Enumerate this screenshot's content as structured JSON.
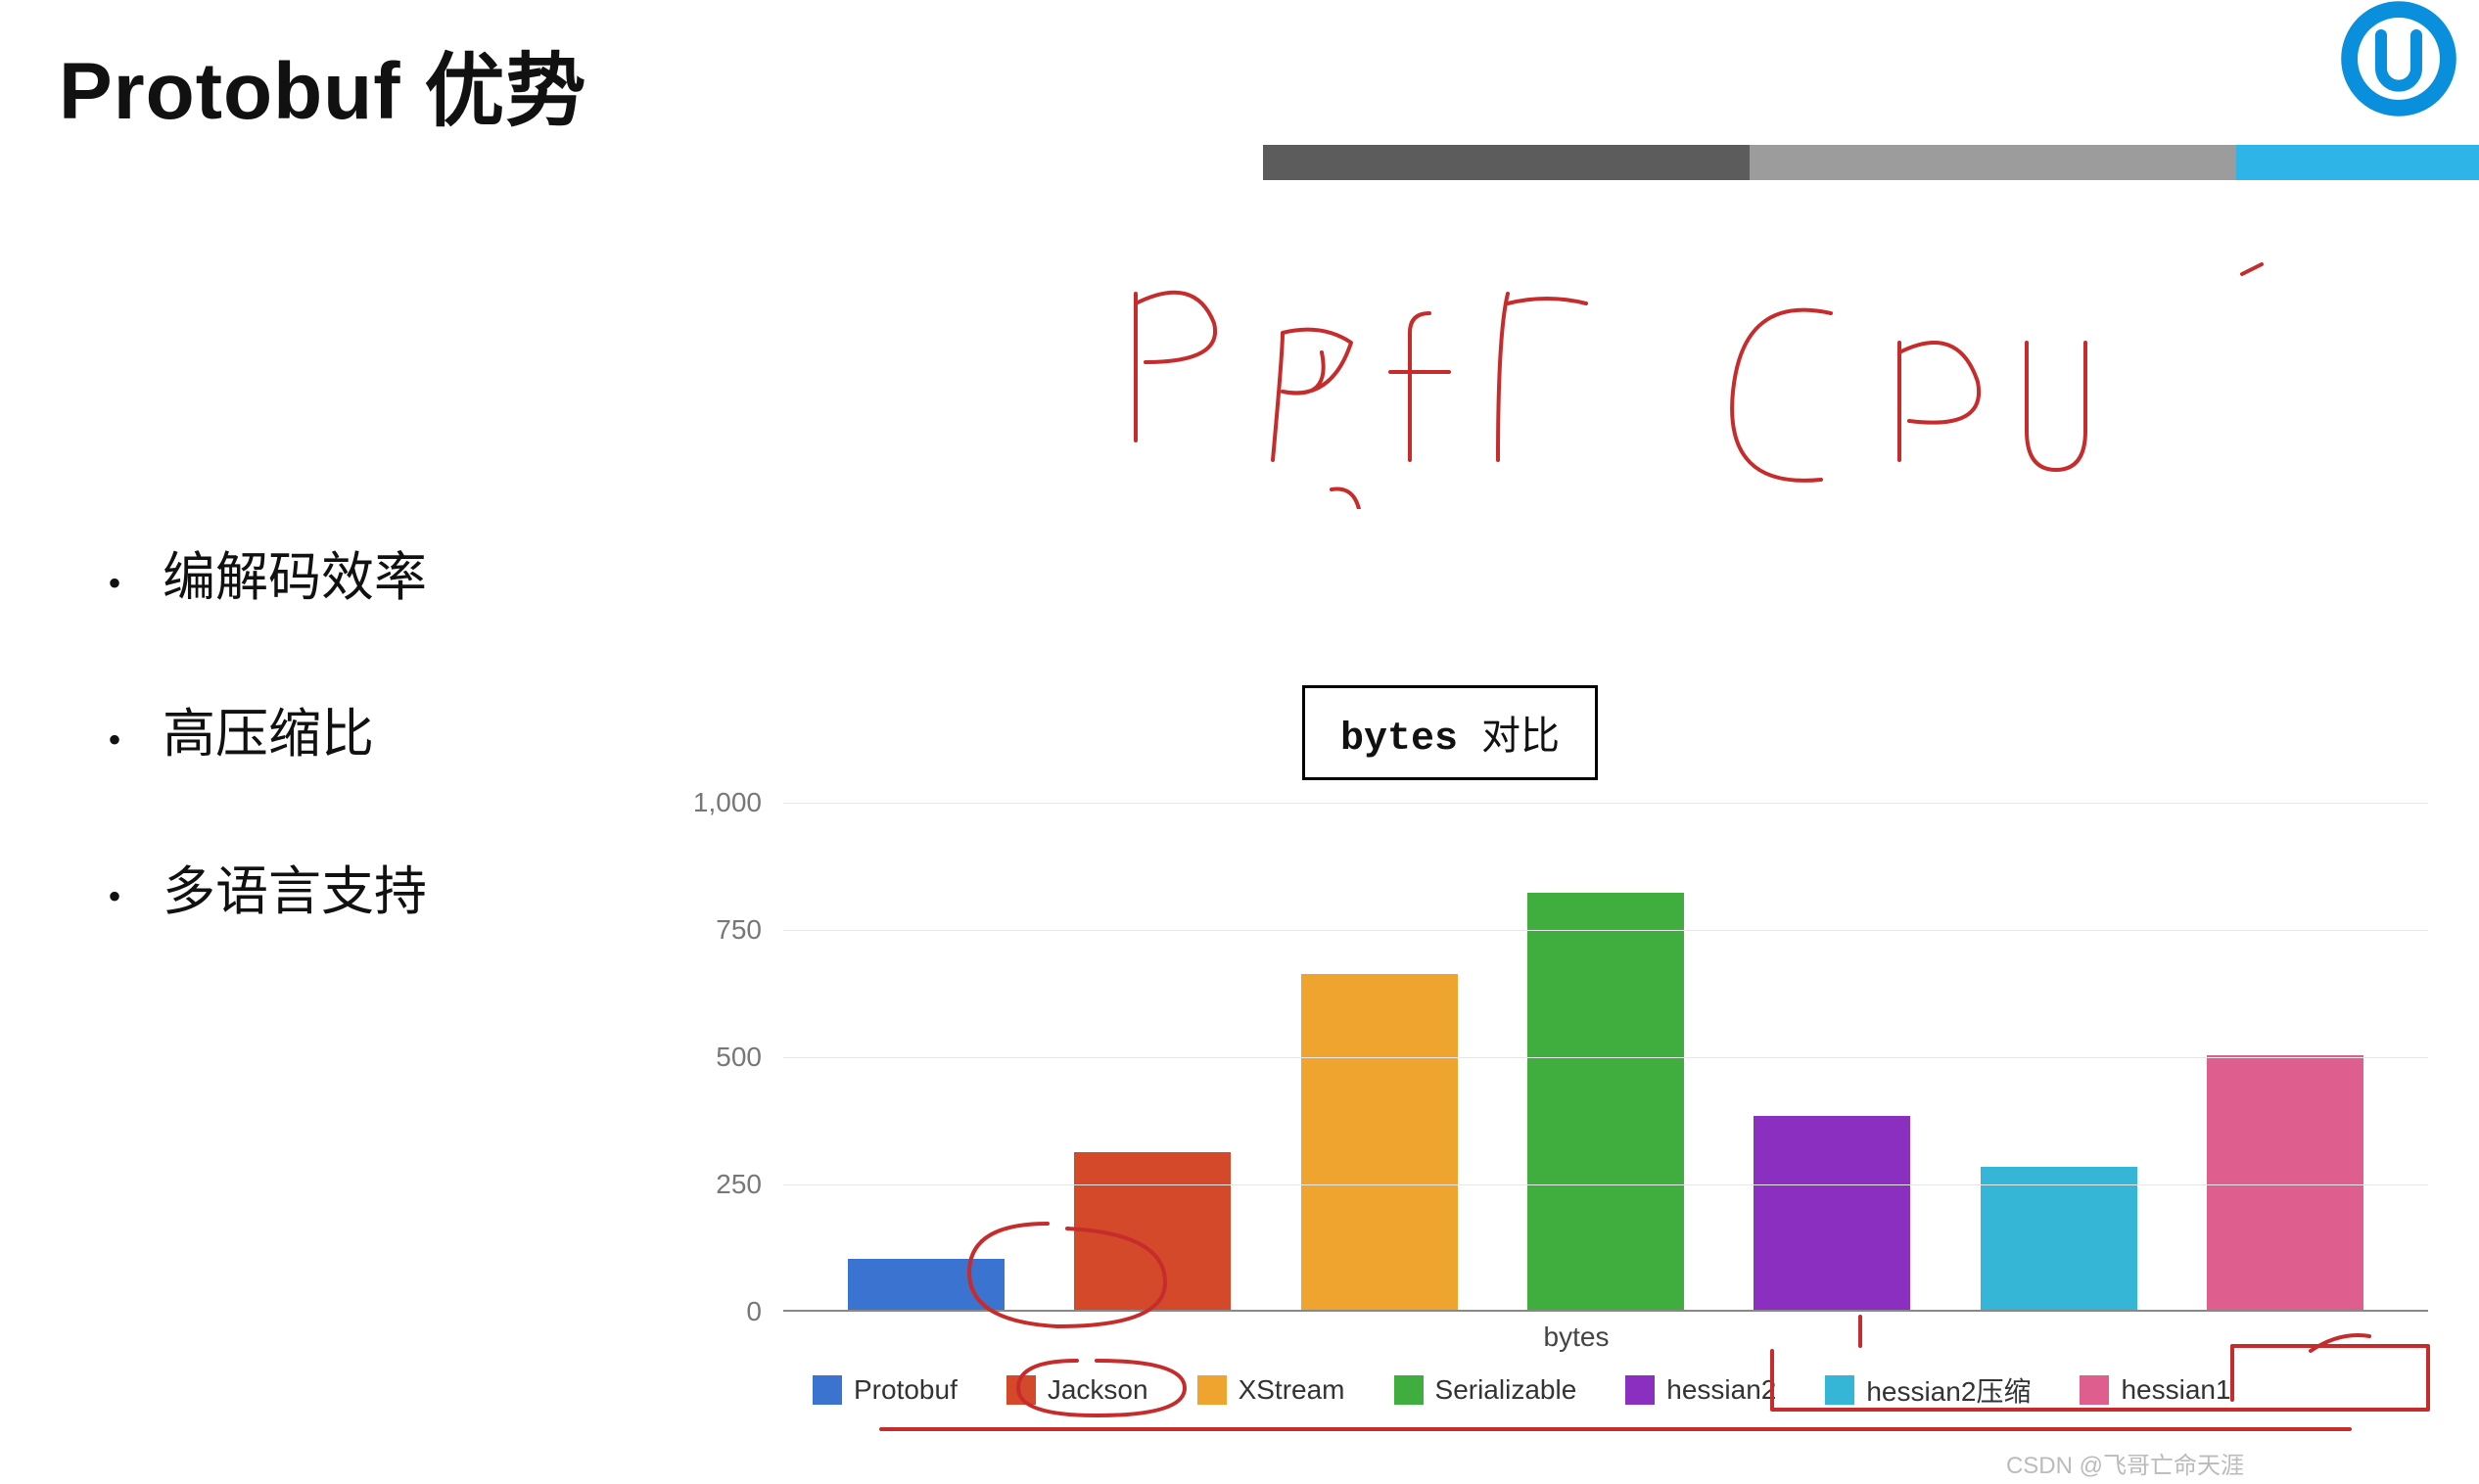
{
  "title": "Protobuf 优势",
  "bullets": [
    "编解码效率",
    "高压缩比",
    "多语言支持"
  ],
  "handwriting": [
    "Perf",
    "Cpu"
  ],
  "chart_data": {
    "type": "bar",
    "title": "bytes 对比",
    "xlabel": "bytes",
    "ylabel": "",
    "ylim": [
      0,
      1000
    ],
    "yticks": [
      0,
      250,
      500,
      750,
      1000
    ],
    "categories": [
      "Protobuf",
      "Jackson",
      "XStream",
      "Serializable",
      "hessian2",
      "hessian2压缩",
      "hessian1"
    ],
    "values": [
      100,
      310,
      660,
      820,
      380,
      280,
      500
    ],
    "colors": [
      "#3b73d1",
      "#d4492a",
      "#f0a430",
      "#3fae3f",
      "#8a2fc0",
      "#35b6d6",
      "#de5f8e"
    ]
  },
  "watermark": "CSDN @飞哥亡命天涯"
}
